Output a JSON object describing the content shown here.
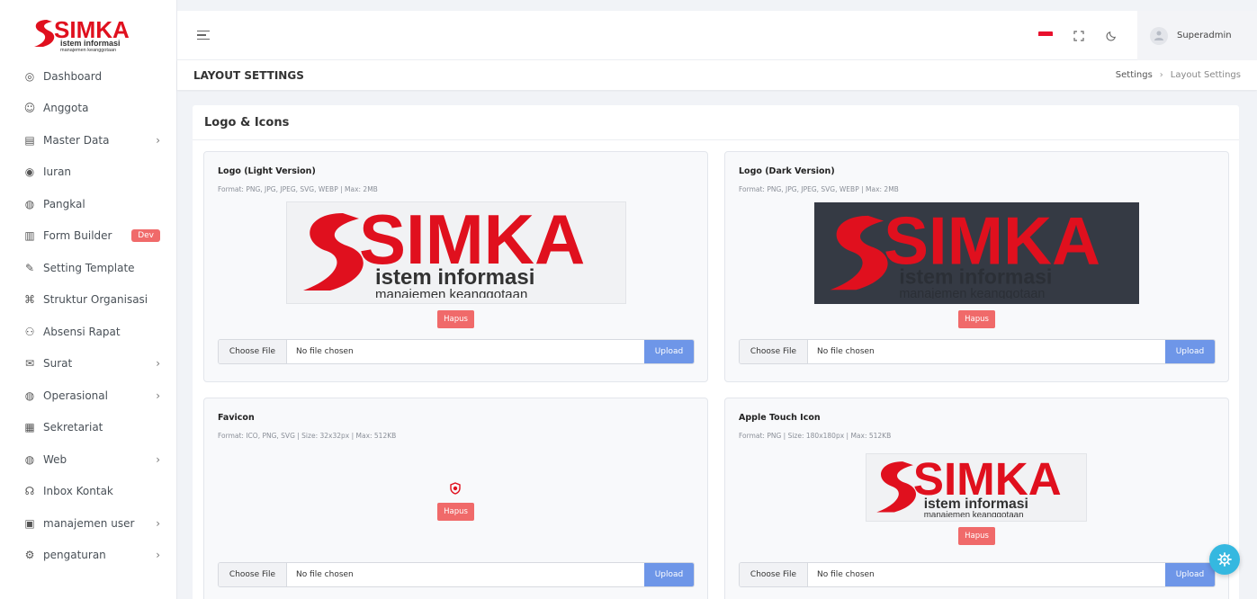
{
  "brand": {
    "logo_text": "SIMKA",
    "logo_sub1": "istem informasi",
    "logo_sub2": "manajemen keanggotaan"
  },
  "sidebar": {
    "items": [
      {
        "label": "Dashboard",
        "icon": "dashboard-icon"
      },
      {
        "label": "Anggota",
        "icon": "user-circle-icon"
      },
      {
        "label": "Master Data",
        "icon": "database-icon"
      },
      {
        "label": "Iuran",
        "icon": "coin-icon"
      },
      {
        "label": "Pangkal",
        "icon": "money-icon"
      },
      {
        "label": "Form Builder",
        "icon": "form-icon",
        "badge": "Dev"
      },
      {
        "label": "Setting Template",
        "icon": "brush-icon"
      },
      {
        "label": "Struktur Organisasi",
        "icon": "org-chart-icon"
      },
      {
        "label": "Absensi Rapat",
        "icon": "users-icon"
      },
      {
        "label": "Surat",
        "icon": "mail-icon"
      },
      {
        "label": "Operasional",
        "icon": "money-icon"
      },
      {
        "label": "Sekretariat",
        "icon": "building-icon"
      },
      {
        "label": "Web",
        "icon": "globe-icon"
      },
      {
        "label": "Inbox Kontak",
        "icon": "headset-icon"
      },
      {
        "label": "manajemen user",
        "icon": "id-card-icon"
      },
      {
        "label": "pengaturan",
        "icon": "settings-icon"
      }
    ]
  },
  "topbar": {
    "user": "Superadmin"
  },
  "page": {
    "title": "LAYOUT SETTINGS",
    "breadcrumb_parent": "Settings",
    "breadcrumb_current": "Layout Settings"
  },
  "card": {
    "title": "Logo & Icons"
  },
  "panels": {
    "logo_light": {
      "title": "Logo (Light Version)",
      "format": "Format: PNG, JPG, JPEG, SVG, WEBP | Max: 2MB"
    },
    "logo_dark": {
      "title": "Logo (Dark Version)",
      "format": "Format: PNG, JPG, JPEG, SVG, WEBP | Max: 2MB"
    },
    "favicon": {
      "title": "Favicon",
      "format": "Format: ICO, PNG, SVG | Size: 32x32px | Max: 512KB"
    },
    "apple": {
      "title": "Apple Touch Icon",
      "format": "Format: PNG | Size: 180x180px | Max: 512KB"
    }
  },
  "common": {
    "hapus": "Hapus",
    "choose_file": "Choose File",
    "no_file": "No file chosen",
    "upload": "Upload"
  },
  "colors": {
    "brand_red": "#e0101e",
    "upload": "#6e96e8",
    "hapus": "#f06a6a",
    "fab": "#35b8e0"
  }
}
